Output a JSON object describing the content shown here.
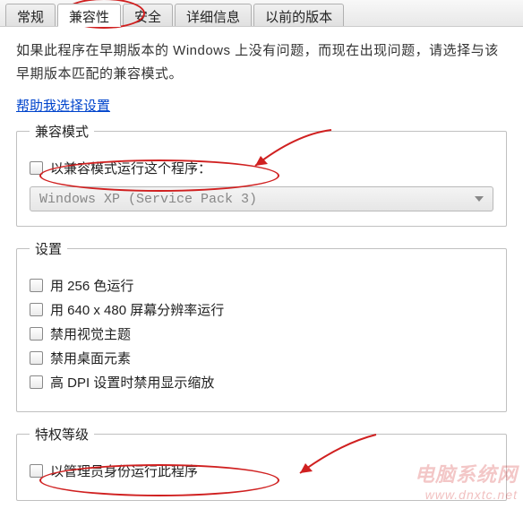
{
  "tabs": {
    "general": "常规",
    "compatibility": "兼容性",
    "security": "安全",
    "details": "详细信息",
    "previous": "以前的版本"
  },
  "description": "如果此程序在早期版本的 Windows 上没有问题，而现在出现问题，请选择与该早期版本匹配的兼容模式。",
  "help_link": "帮助我选择设置",
  "compat_mode": {
    "legend": "兼容模式",
    "checkbox": "以兼容模式运行这个程序：",
    "combo_value": "Windows XP (Service Pack 3)"
  },
  "settings": {
    "legend": "设置",
    "opt_256": "用 256 色运行",
    "opt_640": "用 640 x 480 屏幕分辨率运行",
    "opt_visual": "禁用视觉主题",
    "opt_desktop": "禁用桌面元素",
    "opt_dpi": "高 DPI 设置时禁用显示缩放"
  },
  "privilege": {
    "legend": "特权等级",
    "admin": "以管理员身份运行此程序"
  },
  "watermark": {
    "main": "电脑系统网",
    "domain": "www.dnxtc.net"
  }
}
